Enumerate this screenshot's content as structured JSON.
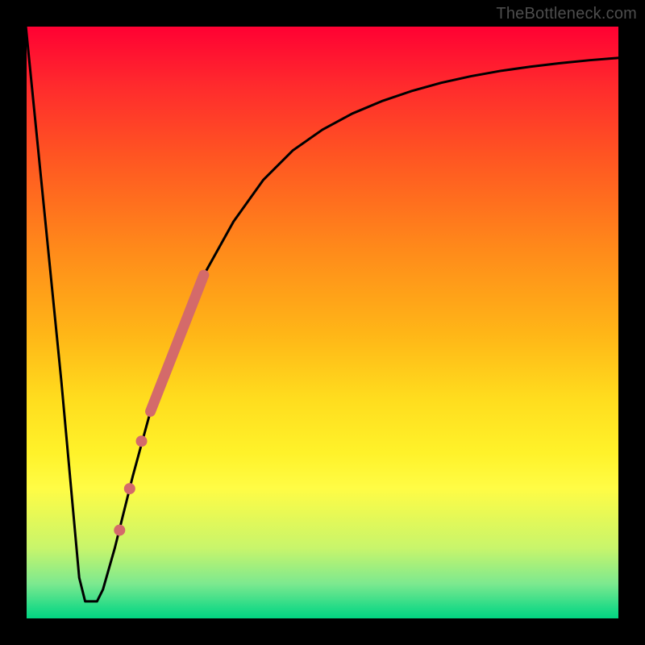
{
  "attribution": "TheBottleneck.com",
  "chart_data": {
    "type": "line",
    "title": "",
    "xlabel": "",
    "ylabel": "",
    "xlim": [
      0,
      100
    ],
    "ylim": [
      0,
      100
    ],
    "grid": false,
    "series": [
      {
        "name": "main-curve",
        "x": [
          0,
          3,
          6,
          8,
          9,
          10,
          11,
          12,
          13,
          15,
          18,
          21,
          24,
          27,
          30,
          35,
          40,
          45,
          50,
          55,
          60,
          65,
          70,
          75,
          80,
          85,
          90,
          95,
          100
        ],
        "y": [
          100,
          70,
          40,
          18,
          7,
          3,
          3,
          3,
          5,
          12,
          24,
          35,
          44,
          52,
          58,
          67,
          74,
          79,
          82.5,
          85.2,
          87.3,
          89,
          90.4,
          91.5,
          92.4,
          93.1,
          93.7,
          94.2,
          94.6
        ]
      }
    ],
    "markers": [
      {
        "name": "highlight-segment",
        "color": "#d46a6a",
        "stroke_width": 13,
        "x": [
          21,
          30
        ],
        "y": [
          35,
          58
        ]
      }
    ],
    "dots": [
      {
        "name": "dot-1",
        "x": 19.5,
        "y": 30,
        "r": 7,
        "color": "#d46a6a"
      },
      {
        "name": "dot-2",
        "x": 17.5,
        "y": 22,
        "r": 7,
        "color": "#d46a6a"
      },
      {
        "name": "dot-3",
        "x": 15.8,
        "y": 15,
        "r": 7,
        "color": "#d46a6a"
      }
    ]
  }
}
